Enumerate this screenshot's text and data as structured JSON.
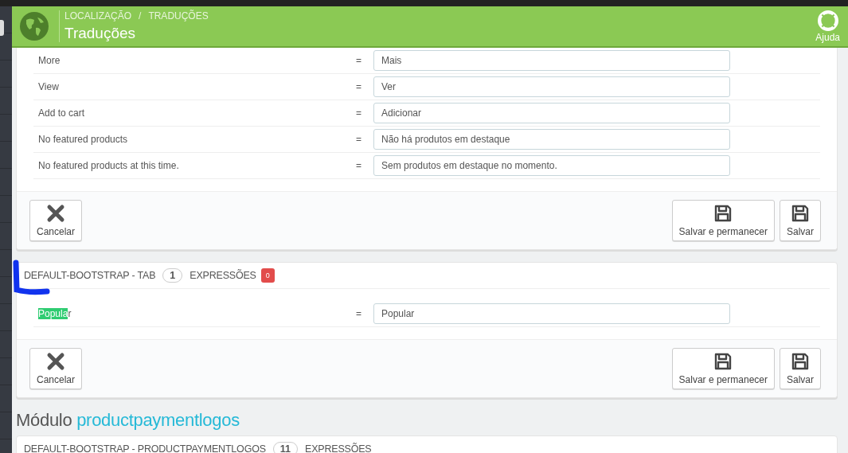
{
  "header": {
    "breadcrumb": [
      "LOCALIZAÇÃO",
      "TRADUÇÕES"
    ],
    "separator": "/",
    "title": "Traduções",
    "help_label": "Ajuda"
  },
  "equals": "=",
  "sections": [
    {
      "rows": [
        {
          "source": "More",
          "translation": "Mais"
        },
        {
          "source": "View",
          "translation": "Ver"
        },
        {
          "source": "Add to cart",
          "translation": "Adicionar"
        },
        {
          "source": "No featured products",
          "translation": "Não há produtos em destaque"
        },
        {
          "source": "No featured products at this time.",
          "translation": "Sem produtos em destaque no momento."
        }
      ],
      "buttons": [
        {
          "label": "Cancelar",
          "kind": "cancel"
        },
        {
          "label": "Salvar e permanecer",
          "kind": "save"
        },
        {
          "label": "Salvar",
          "kind": "save"
        }
      ]
    },
    {
      "heading": {
        "name": "DEFAULT-BOOTSTRAP - TAB",
        "count": "1",
        "label": "EXPRESSÕES",
        "badge": "0"
      },
      "rows": [
        {
          "highlight": "Popula",
          "source": "r",
          "translation": "Popular"
        }
      ],
      "buttons": [
        {
          "label": "Cancelar",
          "kind": "cancel"
        },
        {
          "label": "Salvar e permanecer",
          "kind": "save"
        },
        {
          "label": "Salvar",
          "kind": "save"
        }
      ]
    }
  ],
  "module": {
    "prefix": "Módulo",
    "name": "productpaymentlogos"
  },
  "next_section": {
    "name": "DEFAULT-BOOTSTRAP - PRODUCTPAYMENTLOGOS",
    "count": "11",
    "label": "EXPRESSÕES"
  }
}
